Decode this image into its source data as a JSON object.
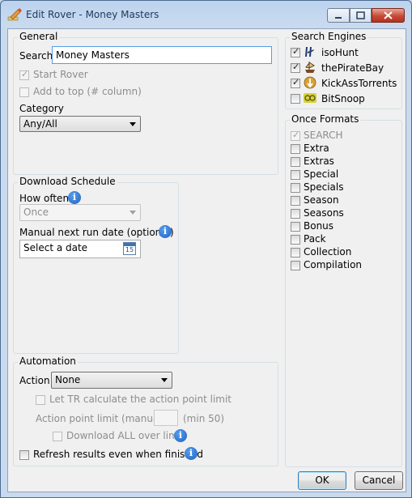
{
  "window": {
    "title": "Edit Rover - Money Masters"
  },
  "general": {
    "group_label": "General",
    "search_label": "Search",
    "search_value": "Money Masters",
    "start_rover_label": "Start Rover",
    "add_to_top_label": "Add to top (# column)",
    "category_label": "Category",
    "category_value": "Any/All"
  },
  "schedule": {
    "group_label": "Download Schedule",
    "how_often_label": "How often",
    "how_often_value": "Once",
    "manual_next_label": "Manual next run date (optional)",
    "date_placeholder": "Select a date",
    "calendar_day": "15"
  },
  "automation": {
    "group_label": "Automation",
    "action_label": "Action",
    "action_value": "None",
    "let_tr_label": "Let TR calculate the action point limit",
    "action_point_label": "Action point limit (manual)",
    "min_label": "(min 50)",
    "download_all_label": "Download ALL over limit",
    "refresh_label": "Refresh results even when finished"
  },
  "search_engines": {
    "group_label": "Search Engines",
    "items": [
      {
        "label": "isoHunt",
        "checked": true,
        "icon": "isohunt-icon"
      },
      {
        "label": "thePirateBay",
        "checked": true,
        "icon": "pirate-ship-icon"
      },
      {
        "label": "KickAssTorrents",
        "checked": true,
        "icon": "kat-icon"
      },
      {
        "label": "BitSnoop",
        "checked": false,
        "icon": "bitsnoop-icon"
      }
    ]
  },
  "once_formats": {
    "group_label": "Once Formats",
    "items": [
      "SEARCH",
      "Extra",
      "Extras",
      "Special",
      "Specials",
      "Season",
      "Seasons",
      "Bonus",
      "Pack",
      "Collection",
      "Compilation"
    ]
  },
  "buttons": {
    "ok": "OK",
    "cancel": "Cancel"
  },
  "info_glyph": "i"
}
